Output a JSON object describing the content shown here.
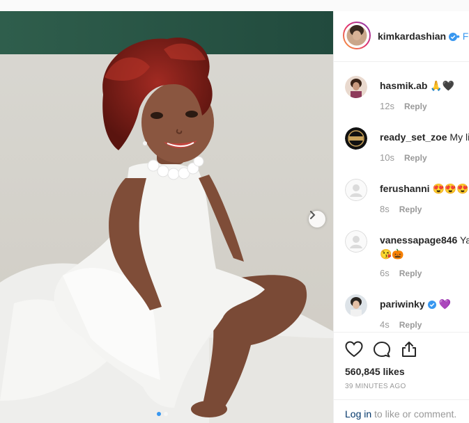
{
  "post": {
    "username": "kimkardashian",
    "follow_label": "• Fo",
    "likes": "560,845 likes",
    "time_ago": "39 MINUTES AGO",
    "login_link": "Log in",
    "login_rest": " to like or comment."
  },
  "comments": [
    {
      "user": "hasmik.ab",
      "text": "🙏🖤",
      "time": "12s",
      "reply": "Reply"
    },
    {
      "user": "ready_set_zoe",
      "text": "My lil",
      "time": "10s",
      "reply": "Reply"
    },
    {
      "user": "ferushanni",
      "text": "😍😍😍❤",
      "time": "8s",
      "reply": "Reply"
    },
    {
      "user": "vanessapage846",
      "text": "Yab",
      "text2": "😘🎃",
      "time": "6s",
      "reply": "Reply"
    },
    {
      "user": "pariwinky",
      "text": "💜",
      "time": "4s",
      "reply": "Reply"
    }
  ],
  "carousel": {
    "pages": 2,
    "active": 1
  },
  "colors": {
    "link": "#3897f0",
    "verified": "#3897f0",
    "text": "#262626",
    "muted": "#999999",
    "border": "#efefef"
  },
  "icons": [
    "chevron-right-icon",
    "verified-badge-icon",
    "heart-icon",
    "comment-icon",
    "share-icon"
  ]
}
